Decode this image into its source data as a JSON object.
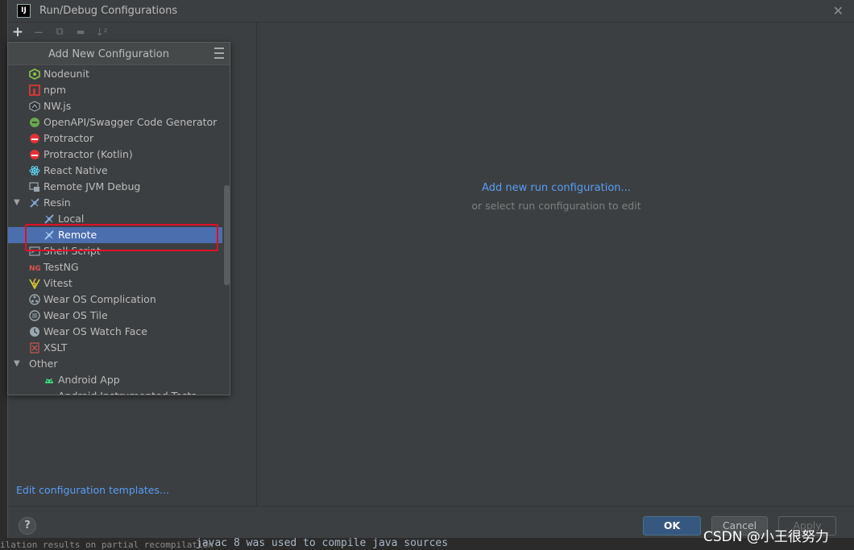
{
  "window": {
    "title": "Run/Debug Configurations",
    "app_icon_text": "IJ"
  },
  "toolbar": {
    "add": "+",
    "remove": "−",
    "copy": "⧉",
    "folder": "▬",
    "sort": "↓²"
  },
  "popup": {
    "title": "Add New Configuration",
    "items": [
      {
        "label": "Nodeunit",
        "icon": "nodeunit-icon",
        "color": "#8cc84b"
      },
      {
        "label": "npm",
        "icon": "npm-icon",
        "color": "#cb3837"
      },
      {
        "label": "NW.js",
        "icon": "nwjs-icon",
        "color": "#9aa7b0"
      },
      {
        "label": "OpenAPI/Swagger Code Generator",
        "icon": "swagger-icon",
        "color": "#6aa84f"
      },
      {
        "label": "Protractor",
        "icon": "protractor-icon",
        "color": "#e23237"
      },
      {
        "label": "Protractor (Kotlin)",
        "icon": "protractor-kotlin-icon",
        "color": "#e23237"
      },
      {
        "label": "React Native",
        "icon": "react-icon",
        "color": "#61dafb"
      },
      {
        "label": "Remote JVM Debug",
        "icon": "remote-debug-icon",
        "color": "#9aa7b0"
      },
      {
        "label": "Resin",
        "icon": "resin-icon",
        "color": "#7fa7d2"
      },
      {
        "label": "Local",
        "icon": "resin-local-icon",
        "color": "#7fa7d2"
      },
      {
        "label": "Remote",
        "icon": "resin-remote-icon",
        "color": "#7fa7d2"
      },
      {
        "label": "Shell Script",
        "icon": "shell-script-icon",
        "color": "#9aa7b0"
      },
      {
        "label": "TestNG",
        "icon": "testng-icon",
        "color": "#d9534f"
      },
      {
        "label": "Vitest",
        "icon": "vitest-icon",
        "color": "#c5d23c"
      },
      {
        "label": "Wear OS Complication",
        "icon": "wear-os-complication-icon",
        "color": "#9aa7b0"
      },
      {
        "label": "Wear OS Tile",
        "icon": "wear-os-tile-icon",
        "color": "#9aa7b0"
      },
      {
        "label": "Wear OS Watch Face",
        "icon": "wear-os-watch-face-icon",
        "color": "#9aa7b0"
      },
      {
        "label": "XSLT",
        "icon": "xslt-icon",
        "color": "#c75450"
      },
      {
        "label": "Other",
        "icon": "",
        "color": ""
      },
      {
        "label": "Android App",
        "icon": "android-icon",
        "color": "#3ddc84"
      },
      {
        "label": "Android Instrumented Tests",
        "icon": "android-test-icon",
        "color": "#3ddc84"
      }
    ]
  },
  "left_panel": {
    "edit_templates": "Edit configuration templates..."
  },
  "right_panel": {
    "link": "Add new run configuration...",
    "sub": "or select run configuration to edit"
  },
  "footer": {
    "help": "?",
    "ok": "OK",
    "cancel": "Cancel",
    "apply": "Apply"
  },
  "background": {
    "console_line": "javac 8 was used to compile java sources",
    "console_left": "ilation results on partial recompilation"
  },
  "watermark": "CSDN @小王很努力",
  "colors": {
    "accent": "#589df6",
    "selection": "#4b6eaf",
    "highlight_box": "#e0102a"
  }
}
